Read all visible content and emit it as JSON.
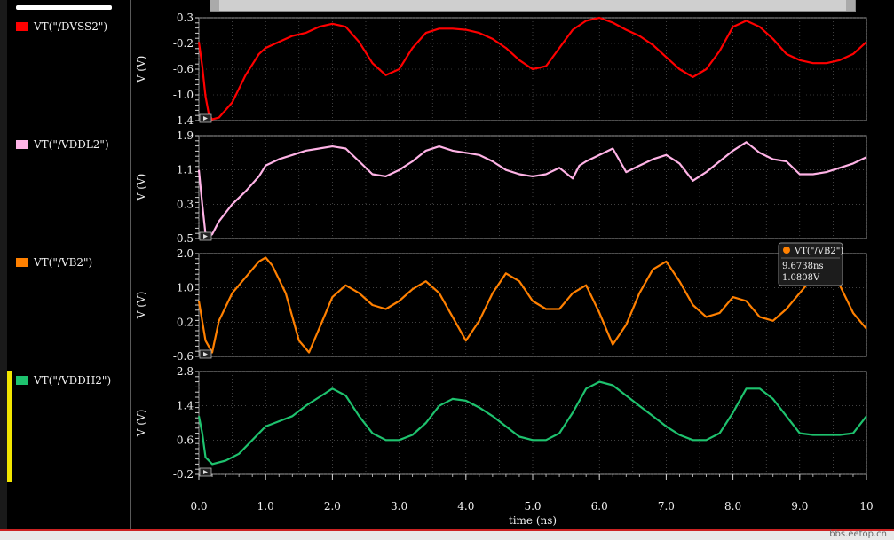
{
  "legend": {
    "items": [
      {
        "label": "VT(\"/DVSS2\")",
        "color": "#ff0000"
      },
      {
        "label": "VT(\"/VDDL2\")",
        "color": "#ffb3e6"
      },
      {
        "label": "VT(\"/VB2\")",
        "color": "#ff8000"
      },
      {
        "label": "VT(\"/VDDH2\")",
        "color": "#1ec26e"
      }
    ]
  },
  "chart_data": {
    "type": "line",
    "xlabel": "time (ns)",
    "xlim": [
      0,
      10
    ],
    "xticks": [
      "0.0",
      "1.0",
      "2.0",
      "3.0",
      "4.0",
      "5.0",
      "6.0",
      "7.0",
      "8.0",
      "9.0",
      "10"
    ],
    "grid": true,
    "panels": [
      {
        "name": "VT(\"/DVSS2\")",
        "color": "#ff0000",
        "ylabel": "V (V)",
        "ylim": [
          -1.4,
          0.3
        ],
        "yticks": [
          "0.3",
          "-0.2",
          "-0.6",
          "-1.0",
          "-1.4"
        ],
        "x": [
          0,
          0.05,
          0.1,
          0.15,
          0.2,
          0.3,
          0.5,
          0.7,
          0.9,
          1.0,
          1.2,
          1.4,
          1.6,
          1.8,
          2.0,
          2.2,
          2.4,
          2.6,
          2.8,
          3.0,
          3.2,
          3.4,
          3.6,
          3.8,
          4.0,
          4.2,
          4.4,
          4.6,
          4.8,
          5.0,
          5.2,
          5.4,
          5.6,
          5.8,
          6.0,
          6.2,
          6.4,
          6.6,
          6.8,
          7.0,
          7.2,
          7.4,
          7.6,
          7.8,
          8.0,
          8.2,
          8.4,
          8.6,
          8.8,
          9.0,
          9.2,
          9.4,
          9.6,
          9.8,
          10.0
        ],
        "y": [
          -0.1,
          -0.5,
          -1.0,
          -1.3,
          -1.38,
          -1.35,
          -1.1,
          -0.65,
          -0.3,
          -0.2,
          -0.1,
          0.0,
          0.05,
          0.15,
          0.2,
          0.15,
          -0.1,
          -0.45,
          -0.65,
          -0.55,
          -0.2,
          0.05,
          0.12,
          0.12,
          0.1,
          0.05,
          -0.05,
          -0.2,
          -0.4,
          -0.55,
          -0.5,
          -0.2,
          0.1,
          0.25,
          0.3,
          0.22,
          0.1,
          0.0,
          -0.15,
          -0.35,
          -0.55,
          -0.68,
          -0.55,
          -0.25,
          0.15,
          0.25,
          0.15,
          -0.05,
          -0.3,
          -0.4,
          -0.45,
          -0.45,
          -0.4,
          -0.3,
          -0.1
        ]
      },
      {
        "name": "VT(\"/VDDL2\")",
        "color": "#ffb3e6",
        "ylabel": "V (V)",
        "ylim": [
          -0.5,
          1.9
        ],
        "yticks": [
          "1.9",
          "1.1",
          "0.3",
          "-0.5"
        ],
        "x": [
          0,
          0.05,
          0.1,
          0.15,
          0.2,
          0.3,
          0.5,
          0.7,
          0.9,
          1.0,
          1.2,
          1.4,
          1.6,
          1.8,
          2.0,
          2.2,
          2.4,
          2.6,
          2.8,
          3.0,
          3.2,
          3.4,
          3.6,
          3.8,
          4.0,
          4.2,
          4.4,
          4.6,
          4.8,
          5.0,
          5.2,
          5.4,
          5.6,
          5.7,
          5.8,
          6.0,
          6.2,
          6.4,
          6.6,
          6.8,
          7.0,
          7.2,
          7.4,
          7.6,
          7.8,
          8.0,
          8.2,
          8.4,
          8.6,
          8.8,
          9.0,
          9.2,
          9.4,
          9.6,
          9.8,
          10.0
        ],
        "y": [
          1.1,
          0.3,
          -0.4,
          -0.45,
          -0.4,
          -0.1,
          0.3,
          0.6,
          0.95,
          1.2,
          1.35,
          1.45,
          1.55,
          1.6,
          1.65,
          1.6,
          1.3,
          1.0,
          0.95,
          1.1,
          1.3,
          1.55,
          1.65,
          1.55,
          1.5,
          1.45,
          1.3,
          1.1,
          1.0,
          0.95,
          1.0,
          1.15,
          0.9,
          1.2,
          1.3,
          1.45,
          1.6,
          1.05,
          1.2,
          1.35,
          1.45,
          1.25,
          0.85,
          1.05,
          1.3,
          1.55,
          1.75,
          1.5,
          1.35,
          1.3,
          1.0,
          1.0,
          1.05,
          1.15,
          1.25,
          1.4
        ]
      },
      {
        "name": "VT(\"/VB2\")",
        "color": "#ff8000",
        "ylabel": "V (V)",
        "ylim": [
          -0.6,
          2.0
        ],
        "yticks": [
          "2.0",
          "1.0",
          "0.2",
          "-0.6"
        ],
        "x": [
          0,
          0.1,
          0.2,
          0.3,
          0.5,
          0.7,
          0.9,
          1.0,
          1.1,
          1.3,
          1.5,
          1.65,
          1.8,
          2.0,
          2.2,
          2.4,
          2.6,
          2.8,
          3.0,
          3.2,
          3.4,
          3.6,
          3.8,
          4.0,
          4.2,
          4.4,
          4.6,
          4.8,
          5.0,
          5.2,
          5.4,
          5.6,
          5.8,
          6.0,
          6.2,
          6.4,
          6.6,
          6.8,
          7.0,
          7.2,
          7.4,
          7.6,
          7.8,
          8.0,
          8.2,
          8.4,
          8.6,
          8.8,
          9.0,
          9.2,
          9.4,
          9.6,
          9.8,
          10.0
        ],
        "y": [
          0.8,
          -0.2,
          -0.5,
          0.3,
          1.0,
          1.4,
          1.8,
          1.9,
          1.7,
          1.0,
          -0.2,
          -0.5,
          0.1,
          0.9,
          1.2,
          1.0,
          0.7,
          0.6,
          0.8,
          1.1,
          1.3,
          1.0,
          0.4,
          -0.2,
          0.3,
          1.0,
          1.5,
          1.3,
          0.8,
          0.6,
          0.6,
          1.0,
          1.2,
          0.5,
          -0.3,
          0.2,
          1.0,
          1.6,
          1.8,
          1.3,
          0.7,
          0.4,
          0.5,
          0.9,
          0.8,
          0.4,
          0.3,
          0.6,
          1.0,
          1.4,
          1.6,
          1.2,
          0.5,
          0.1
        ]
      },
      {
        "name": "VT(\"/VDDH2\")",
        "color": "#1ec26e",
        "ylabel": "V (V)",
        "ylim": [
          -0.2,
          2.8
        ],
        "yticks": [
          "2.8",
          "1.4",
          "0.6",
          "-0.2"
        ],
        "x": [
          0,
          0.05,
          0.1,
          0.2,
          0.4,
          0.6,
          0.8,
          1.0,
          1.2,
          1.4,
          1.6,
          1.8,
          2.0,
          2.2,
          2.4,
          2.6,
          2.8,
          3.0,
          3.2,
          3.4,
          3.6,
          3.8,
          4.0,
          4.2,
          4.4,
          4.6,
          4.8,
          5.0,
          5.2,
          5.4,
          5.6,
          5.8,
          6.0,
          6.2,
          6.4,
          6.6,
          6.8,
          7.0,
          7.2,
          7.4,
          7.6,
          7.8,
          8.0,
          8.2,
          8.4,
          8.6,
          8.8,
          9.0,
          9.2,
          9.4,
          9.6,
          9.8,
          10.0
        ],
        "y": [
          1.5,
          1.0,
          0.3,
          0.1,
          0.2,
          0.4,
          0.8,
          1.2,
          1.35,
          1.5,
          1.8,
          2.05,
          2.3,
          2.1,
          1.5,
          1.0,
          0.8,
          0.8,
          0.95,
          1.3,
          1.8,
          2.0,
          1.95,
          1.75,
          1.5,
          1.2,
          0.9,
          0.8,
          0.8,
          1.0,
          1.6,
          2.3,
          2.5,
          2.4,
          2.1,
          1.8,
          1.5,
          1.2,
          0.95,
          0.8,
          0.8,
          1.0,
          1.6,
          2.3,
          2.3,
          2.0,
          1.5,
          1.0,
          0.95,
          0.95,
          0.95,
          1.0,
          1.5
        ]
      }
    ]
  },
  "marker": {
    "label": "VT(\"/VB2\")",
    "x_text": "9.6738ns",
    "y_text": "1.0808V",
    "color": "#ff8000"
  },
  "watermark": "bbs.eetop.cn"
}
